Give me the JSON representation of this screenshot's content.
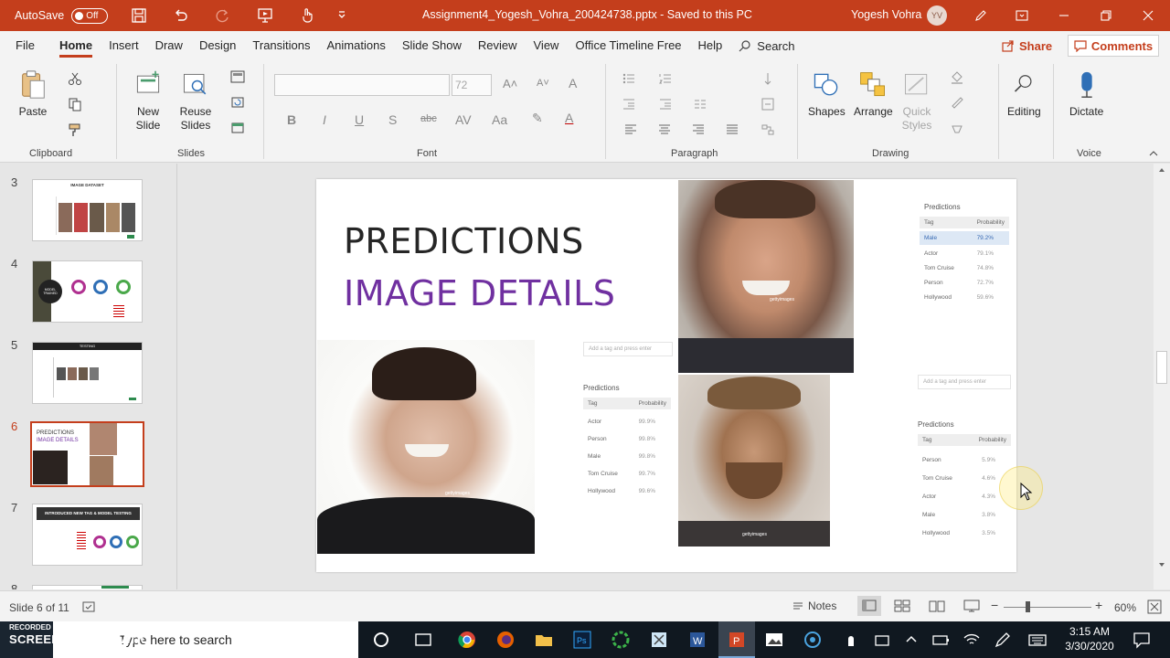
{
  "titlebar": {
    "autosave_label": "AutoSave",
    "autosave_state": "Off",
    "document_title": "Assignment4_Yogesh_Vohra_200424738.pptx  -  Saved to this PC",
    "user_name": "Yogesh Vohra",
    "user_initials": "YV",
    "accent_color": "#c43e1c"
  },
  "tabs": [
    "File",
    "Home",
    "Insert",
    "Draw",
    "Design",
    "Transitions",
    "Animations",
    "Slide Show",
    "Review",
    "View",
    "Office Timeline Free",
    "Help"
  ],
  "active_tab": "Home",
  "search_label": "Search",
  "share_label": "Share",
  "comments_label": "Comments",
  "ribbon": {
    "clipboard": {
      "paste": "Paste",
      "group": "Clipboard"
    },
    "slides": {
      "new_slide_1": "New",
      "new_slide_2": "Slide",
      "reuse_1": "Reuse",
      "reuse_2": "Slides",
      "group": "Slides"
    },
    "font": {
      "font_name": "",
      "font_size": "72",
      "group": "Font",
      "bold": "B",
      "italic": "I",
      "underline": "U",
      "shadow": "S",
      "strike": "abc",
      "case": "Aa"
    },
    "paragraph": {
      "group": "Paragraph"
    },
    "drawing": {
      "shapes": "Shapes",
      "arrange": "Arrange",
      "quick_styles_1": "Quick",
      "quick_styles_2": "Styles",
      "group": "Drawing"
    },
    "editing": {
      "label": "Editing"
    },
    "voice": {
      "dictate": "Dictate",
      "group": "Voice"
    }
  },
  "thumbnails": [
    {
      "number": "3",
      "title": "IMAGE DATASET",
      "active": false
    },
    {
      "number": "4",
      "title": "MODEL TRAINED",
      "active": false
    },
    {
      "number": "5",
      "title": "TESTING",
      "active": false
    },
    {
      "number": "6",
      "title": "PREDICTIONS",
      "subtitle": "IMAGE DETAILS",
      "active": true
    },
    {
      "number": "7",
      "title": "INTRODUCED NEW TAG & MODEL TESTING",
      "active": false
    },
    {
      "number": "8",
      "title": "",
      "active": false
    }
  ],
  "slide": {
    "title_line1": "PREDICTIONS",
    "title_line2": "IMAGE DETAILS",
    "title_color2": "#7030a0",
    "tag_placeholder": "Add a tag and press enter",
    "predictions_heading": "Predictions",
    "col_tag": "Tag",
    "col_probability": "Probability",
    "watermark": "gettyimages",
    "panel_a": [
      {
        "tag": "Male",
        "prob": "79.2%"
      },
      {
        "tag": "Actor",
        "prob": "79.1%"
      },
      {
        "tag": "Tom Cruise",
        "prob": "74.8%"
      },
      {
        "tag": "Person",
        "prob": "72.7%"
      },
      {
        "tag": "Hollywood",
        "prob": "59.6%"
      }
    ],
    "panel_b": [
      {
        "tag": "Actor",
        "prob": "99.9%"
      },
      {
        "tag": "Person",
        "prob": "99.8%"
      },
      {
        "tag": "Male",
        "prob": "99.8%"
      },
      {
        "tag": "Tom Cruise",
        "prob": "99.7%"
      },
      {
        "tag": "Hollywood",
        "prob": "99.6%"
      }
    ],
    "panel_c": [
      {
        "tag": "Person",
        "prob": "5.9%"
      },
      {
        "tag": "Tom Cruise",
        "prob": "4.6%"
      },
      {
        "tag": "Actor",
        "prob": "4.3%"
      },
      {
        "tag": "Male",
        "prob": "3.8%"
      },
      {
        "tag": "Hollywood",
        "prob": "3.5%"
      }
    ]
  },
  "statusbar": {
    "slide_info": "Slide 6 of 11",
    "notes": "Notes",
    "zoom": "60%"
  },
  "taskbar": {
    "search_placeholder": "Type here to search",
    "recorded_with": "RECORDED WITH",
    "brand": "SCREENCAST-O-MATIC",
    "time": "3:15 AM",
    "date": "3/30/2020"
  }
}
